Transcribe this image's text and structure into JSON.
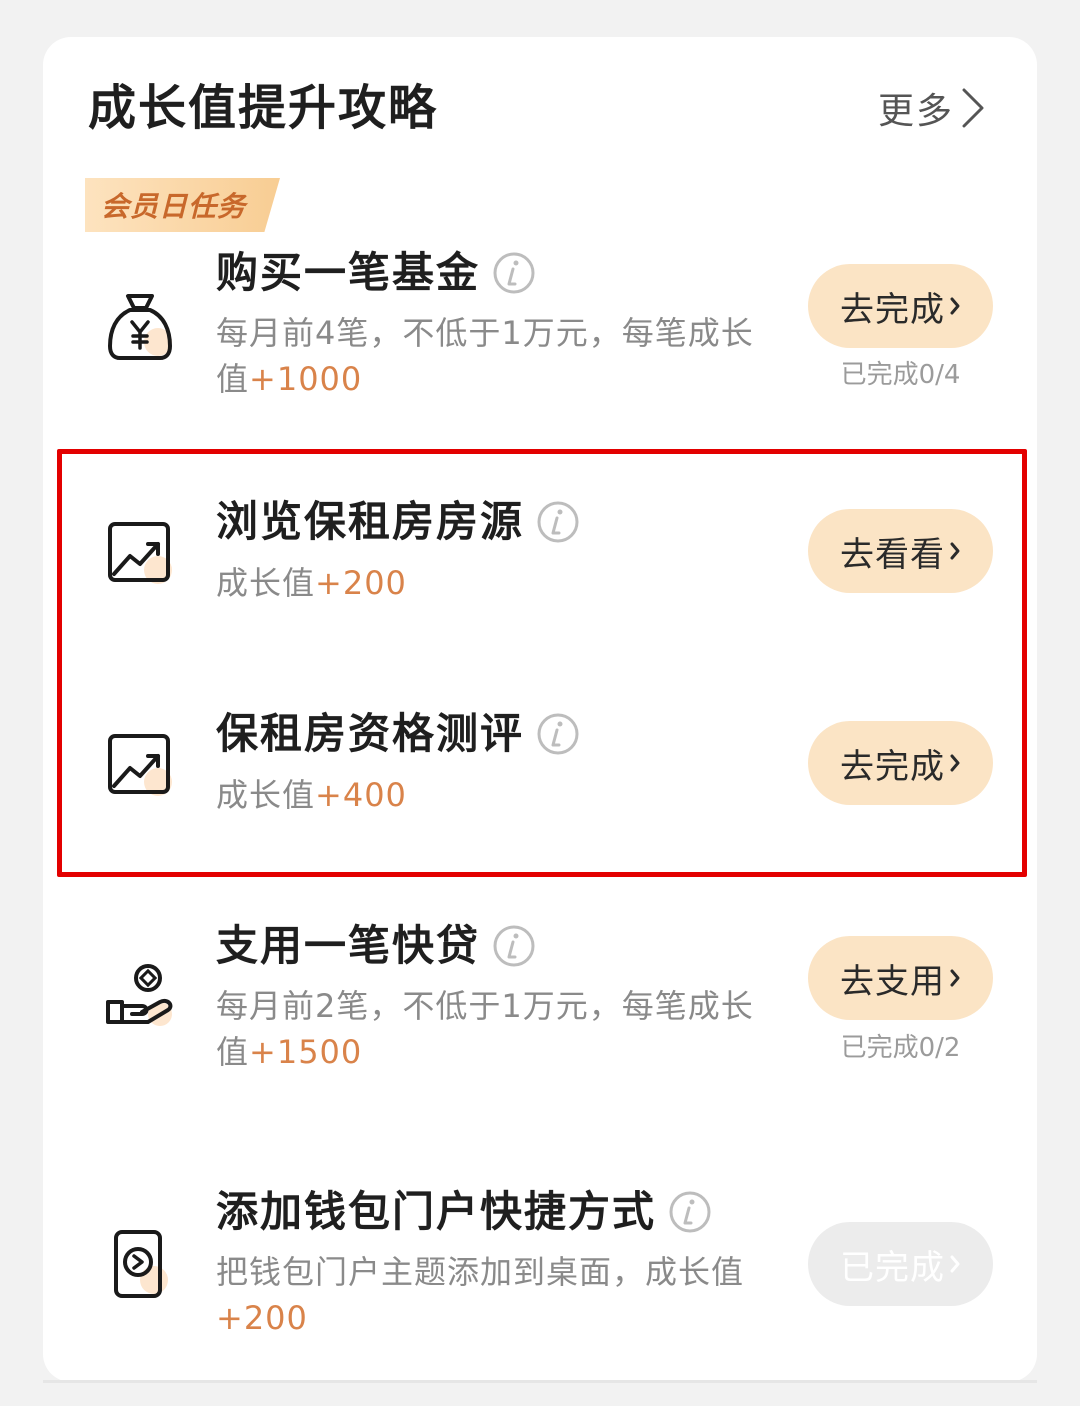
{
  "section": {
    "title": "成长值提升攻略",
    "more_label": "更多",
    "tag_label": "会员日任务"
  },
  "colors": {
    "accent": "#d9834a",
    "button_bg": "#fbe4c5",
    "highlight_border": "#e30000"
  },
  "tasks": [
    {
      "icon": "money-bag-icon",
      "title": "购买一笔基金",
      "desc_prefix": "每月前4笔，不低于1万元，每笔成长值",
      "desc_plus": "+1000",
      "button_label": "去完成",
      "progress": "已完成0/4"
    },
    {
      "icon": "growth-chart-icon",
      "title": "浏览保租房房源",
      "desc_prefix": "成长值",
      "desc_plus": "+200",
      "button_label": "去看看"
    },
    {
      "icon": "growth-chart-icon",
      "title": "保租房资格测评",
      "desc_prefix": "成长值",
      "desc_plus": "+400",
      "button_label": "去完成"
    },
    {
      "icon": "hand-coin-icon",
      "title": "支用一笔快贷",
      "desc_prefix": "每月前2笔，不低于1万元，每笔成长值",
      "desc_plus": "+1500",
      "button_label": "去支用",
      "progress": "已完成0/2"
    },
    {
      "icon": "wallet-card-icon",
      "title": "添加钱包门户快捷方式",
      "desc_prefix": "把钱包门户主题添加到桌面，成长值",
      "desc_plus": "+200",
      "button_label": "已完成"
    }
  ]
}
